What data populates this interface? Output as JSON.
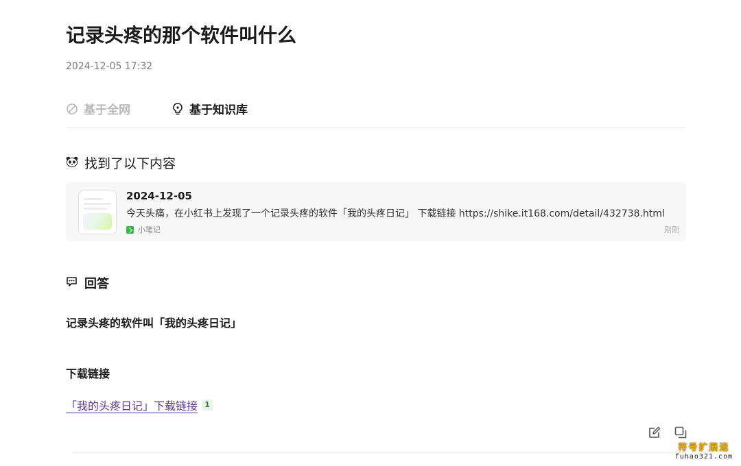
{
  "page": {
    "title": "记录头疼的那个软件叫什么",
    "date": "2024-12-05 17:32"
  },
  "tabs": [
    {
      "label": "基于全网",
      "active": false,
      "icon": "globe-slash-icon"
    },
    {
      "label": "基于知识库",
      "active": true,
      "icon": "lightbulb-icon"
    }
  ],
  "found": {
    "label": "找到了以下内容",
    "icon": "panda-icon"
  },
  "result_card": {
    "date": "2024-12-05",
    "text": "今天头痛，在小红书上发现了一个记录头疼的软件「我的头疼日记」 下载链接 https://shike.it168.com/detail/432738.html",
    "source": "小笔记",
    "time": "刚刚"
  },
  "answer": {
    "heading": "回答",
    "line1": "记录头疼的软件叫「我的头疼日记」",
    "line2": "下载链接",
    "link_text": "「我的头疼日记」下载链接",
    "citation": "1"
  },
  "actions": [
    {
      "name": "edit-icon"
    },
    {
      "name": "copy-icon"
    }
  ],
  "watermark": {
    "cn": "符号扩展迷",
    "en": "fuhao321.com"
  },
  "colors": {
    "accent_green": "#39b54a",
    "link": "#5b3a8c",
    "muted": "#b8b8b8",
    "watermark": "#e8a90c"
  }
}
